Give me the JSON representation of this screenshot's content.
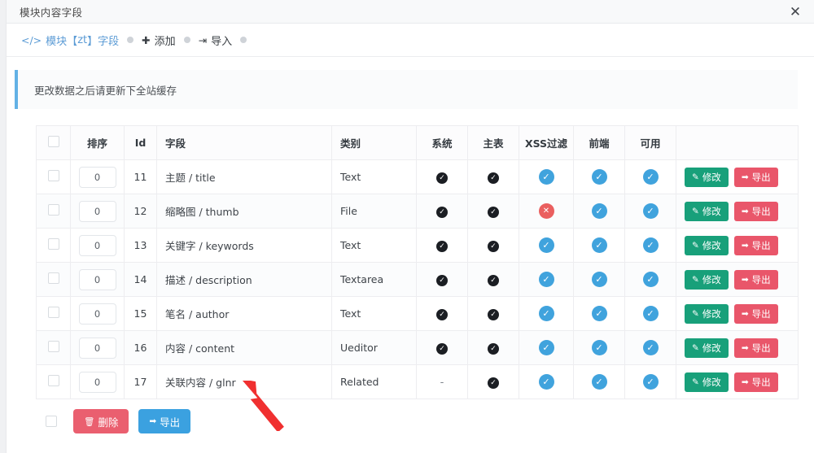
{
  "window": {
    "title": "模块内容字段",
    "close_label": "✕"
  },
  "toolbar": {
    "items": [
      {
        "icon": "code-icon",
        "icon_glyph": "</>",
        "label_prefix": "模块【",
        "label_zt": "zt",
        "label_suffix": "】字段",
        "style": "link"
      },
      {
        "icon": "plus-icon",
        "icon_glyph": "✚",
        "label": "添加",
        "style": "dark"
      },
      {
        "icon": "import-icon",
        "icon_glyph": "⇥",
        "label": "导入",
        "style": "dark"
      }
    ]
  },
  "alert": {
    "text": "更改数据之后请更新下全站缓存",
    "border_color": "#63b1e5",
    "background": "#fafbfc"
  },
  "table": {
    "headers": {
      "select": "",
      "sort": "排序",
      "id": "Id",
      "field": "字段",
      "type": "类别",
      "system": "系统",
      "main_table": "主表",
      "xss_filter": "XSS过滤",
      "frontend": "前端",
      "available": "可用",
      "actions": ""
    },
    "rows": [
      {
        "sort": "0",
        "id": "11",
        "field": "主题 / title",
        "type": "Text",
        "system": "check-dark",
        "main_table": "check-dark",
        "xss_filter": "check-blue",
        "frontend": "check-blue",
        "available": "check-blue"
      },
      {
        "sort": "0",
        "id": "12",
        "field": "缩略图 / thumb",
        "type": "File",
        "system": "check-dark",
        "main_table": "check-dark",
        "xss_filter": "cross-red",
        "frontend": "check-blue",
        "available": "check-blue"
      },
      {
        "sort": "0",
        "id": "13",
        "field": "关键字 / keywords",
        "type": "Text",
        "system": "check-dark",
        "main_table": "check-dark",
        "xss_filter": "check-blue",
        "frontend": "check-blue",
        "available": "check-blue"
      },
      {
        "sort": "0",
        "id": "14",
        "field": "描述 / description",
        "type": "Textarea",
        "system": "check-dark",
        "main_table": "check-dark",
        "xss_filter": "check-blue",
        "frontend": "check-blue",
        "available": "check-blue"
      },
      {
        "sort": "0",
        "id": "15",
        "field": "笔名 / author",
        "type": "Text",
        "system": "check-dark",
        "main_table": "check-dark",
        "xss_filter": "check-blue",
        "frontend": "check-blue",
        "available": "check-blue"
      },
      {
        "sort": "0",
        "id": "16",
        "field": "内容 / content",
        "type": "Ueditor",
        "system": "check-dark",
        "main_table": "check-dark",
        "xss_filter": "check-blue",
        "frontend": "check-blue",
        "available": "check-blue"
      },
      {
        "sort": "0",
        "id": "17",
        "field": "关联内容 / glnr",
        "type": "Related",
        "system": "dash",
        "main_table": "check-dark",
        "xss_filter": "check-blue",
        "frontend": "check-blue",
        "available": "check-blue"
      }
    ],
    "row_actions": {
      "edit_label": "修改",
      "edit_icon": "✎",
      "export_label": "导出",
      "export_icon": "➡"
    }
  },
  "bottom": {
    "delete_label": "删除",
    "delete_icon": "🗑",
    "export_label": "导出",
    "export_icon": "➡"
  },
  "colors": {
    "link": "#5b9bd5",
    "edit_green": "#18a07a",
    "export_red": "#e9566a",
    "export_blue": "#3ba1e0",
    "delete_red": "#ea5f6f",
    "check_blue": "#40a3dd",
    "cross_red": "#ea5f5f",
    "check_dark": "#1b1e23",
    "annotation_arrow": "#f03030"
  }
}
